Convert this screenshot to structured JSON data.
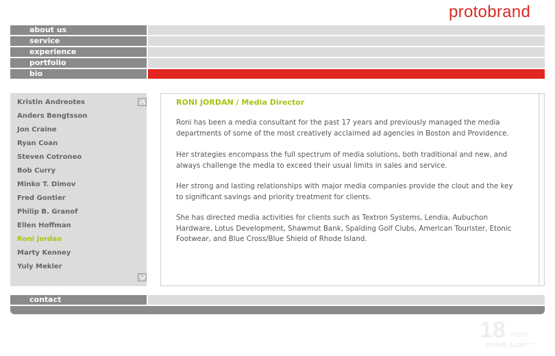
{
  "brand": {
    "logo_text": "protobrand"
  },
  "nav": {
    "items": [
      {
        "label": "about us",
        "active": false
      },
      {
        "label": "service",
        "active": false
      },
      {
        "label": "experience",
        "active": false
      },
      {
        "label": "portfolio",
        "active": false
      },
      {
        "label": "bio",
        "active": true
      }
    ],
    "contact": "contact"
  },
  "people": {
    "list": [
      "Kristin Andreotes",
      "Anders Bengtsson",
      "Jon Craine",
      "Ryan Coan",
      "Steven Cotroneo",
      "Bob Curry",
      "Minko T. Dimov",
      "Fred Gontier",
      "Philip B. Granof",
      "Ellen Hoffman",
      "Roni Jordan",
      "Marty Kenney",
      "Yuly Mekler"
    ],
    "selected_index": 10
  },
  "bio": {
    "title": "RONI JORDAN / Media Director",
    "paragraphs": [
      "Roni has been a media consultant for the past 17 years and previously managed the media departments of some of the most creatively acclaimed ad agencies in Boston and Providence.",
      "Her strategies encompass the full spectrum of media solutions, both traditional and new, and always challenge the media to exceed their usual limits in sales and service.",
      "Her strong and lasting relationships with major media companies provide the clout and the key to significant savings and priority treatment for clients.",
      "She has directed media activities for clients such as Textron Systems, Lendia, Aubuchon Hardware, Lotus Development, Shawmut Bank, Spalding Golf Clubs, American Tourister, Etonic Footwear, and Blue Cross/Blue Shield of Rhode Island."
    ]
  },
  "badge": {
    "number": "18",
    "point": "POINT",
    "audit": "BRAND AUDIT™"
  },
  "colors": {
    "accent_red": "#e1271f",
    "selected_green": "#a8c214",
    "nav_gray": "#8a8a8a",
    "bar_gray": "#dcdcdc"
  },
  "icons": {
    "scroll_up": "chevron-up-icon",
    "scroll_down": "chevron-down-icon"
  }
}
